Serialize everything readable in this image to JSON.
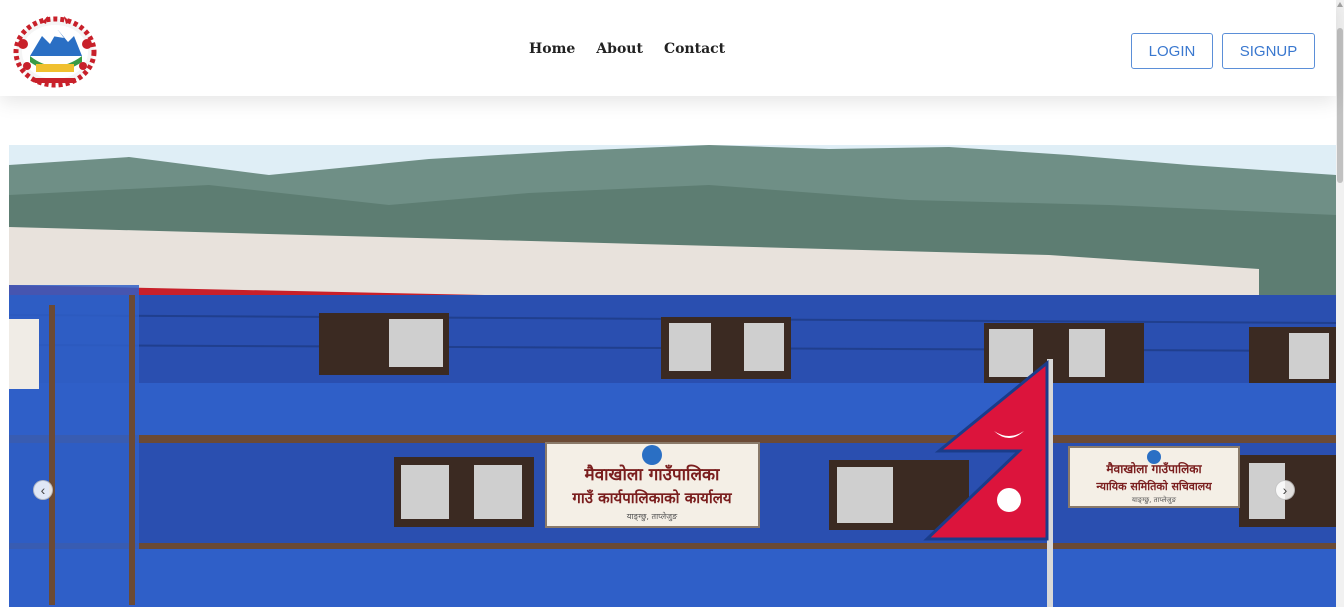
{
  "nav": {
    "links": [
      "Home",
      "About",
      "Contact"
    ],
    "login_label": "LOGIN",
    "signup_label": "SIGNUP"
  },
  "carousel": {
    "sign_main_line1": "मैवाखोला गाउँपालिका",
    "sign_main_line2": "गाउँ कार्यपालिकाको कार्यालय",
    "sign_main_line3": "याङ्ग्छु, ताप्लेजुङ",
    "sign_right_line1": "मैवाखोला गाउँपालिका",
    "sign_right_line2": "न्यायिक समितिको सचिवालय",
    "sign_right_line3": "याङ्ग्छु, ताप्लेजुङ",
    "prev_icon": "chevron-left-icon",
    "next_icon": "chevron-right-icon"
  },
  "colors": {
    "accent": "#3a78cf",
    "building_blue": "#2a4fb0",
    "roof_red": "#c8202a",
    "flag_red": "#dc143c"
  }
}
